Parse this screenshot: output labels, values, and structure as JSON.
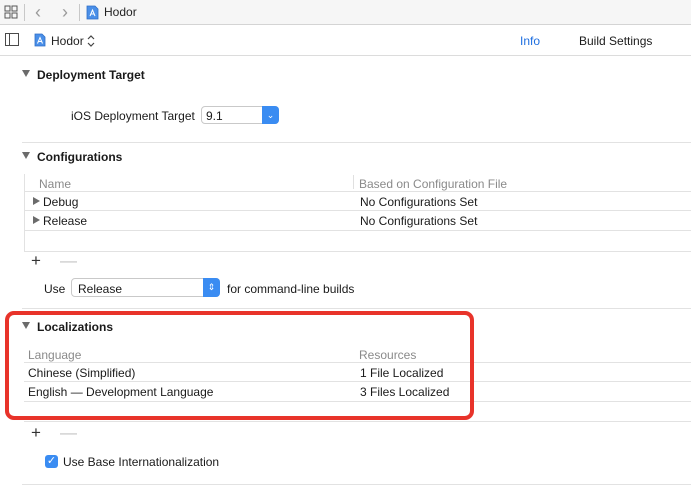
{
  "jumpbar": {
    "grid_icon": "grid-icon",
    "back_icon": "chevron-left-icon",
    "forward_icon": "chevron-right-icon",
    "file_icon": "project-file-icon",
    "title": "Hodor"
  },
  "tabbar": {
    "sidebar_icon": "sidebar-toggle-icon",
    "project_name": "Hodor",
    "project_chevron": "⌃⌄",
    "tabs": [
      {
        "label": "Info",
        "selected": true
      },
      {
        "label": "Build Settings",
        "selected": false
      }
    ],
    "selected_color": "#1f6fe0"
  },
  "deployment": {
    "title": "Deployment Target",
    "label": "iOS Deployment Target",
    "value": "9.1"
  },
  "configurations": {
    "title": "Configurations",
    "columns": [
      "Name",
      "Based on Configuration File"
    ],
    "rows": [
      {
        "name": "Debug",
        "file": "No Configurations Set"
      },
      {
        "name": "Release",
        "file": "No Configurations Set"
      }
    ],
    "add_label": "+",
    "remove_label": "—",
    "use_label": "Use",
    "use_value": "Release",
    "use_suffix": "for command-line builds"
  },
  "localizations": {
    "title": "Localizations",
    "columns": [
      "Language",
      "Resources"
    ],
    "rows": [
      {
        "language": "Chinese (Simplified)",
        "resources": "1 File Localized"
      },
      {
        "language": "English — Development Language",
        "resources": "3 Files Localized"
      }
    ],
    "add_label": "+",
    "remove_label": "—",
    "base_i18n_label": "Use Base Internationalization",
    "base_i18n_checked": true,
    "highlight_color": "#e8332a"
  }
}
